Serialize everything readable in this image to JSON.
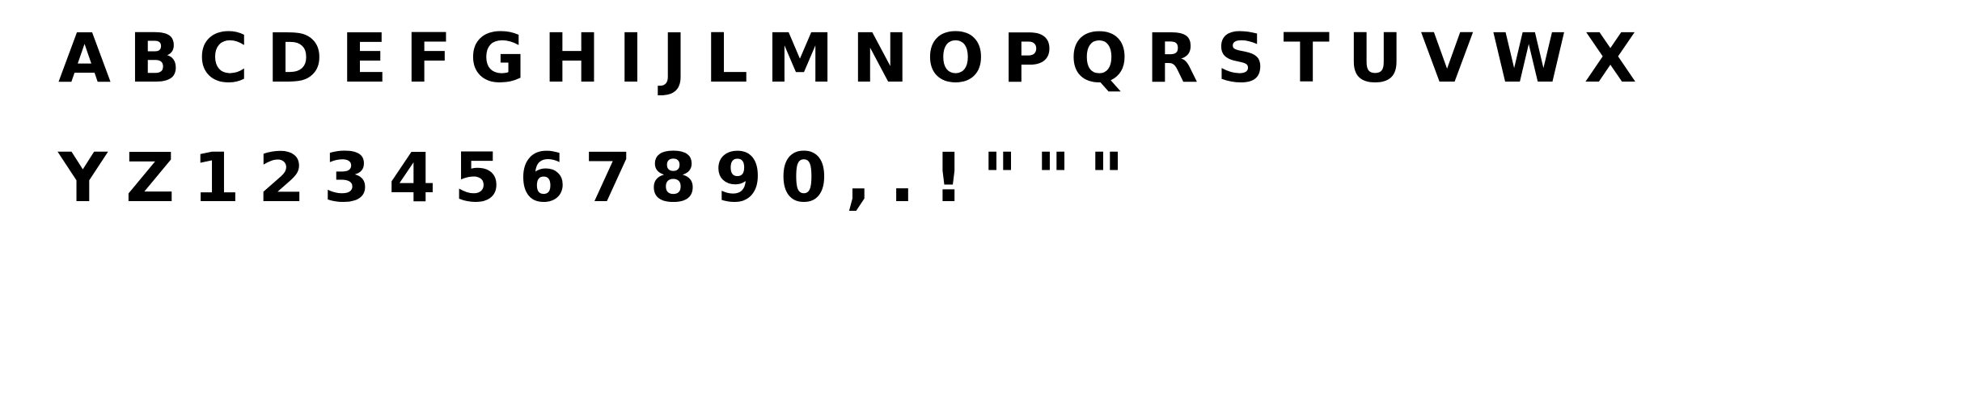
{
  "glyph_sheet": {
    "lines": [
      "ABCDEFGHIJLMNOPQRSTUVWX",
      "YZ1234567890,.!\"\"\""
    ]
  }
}
